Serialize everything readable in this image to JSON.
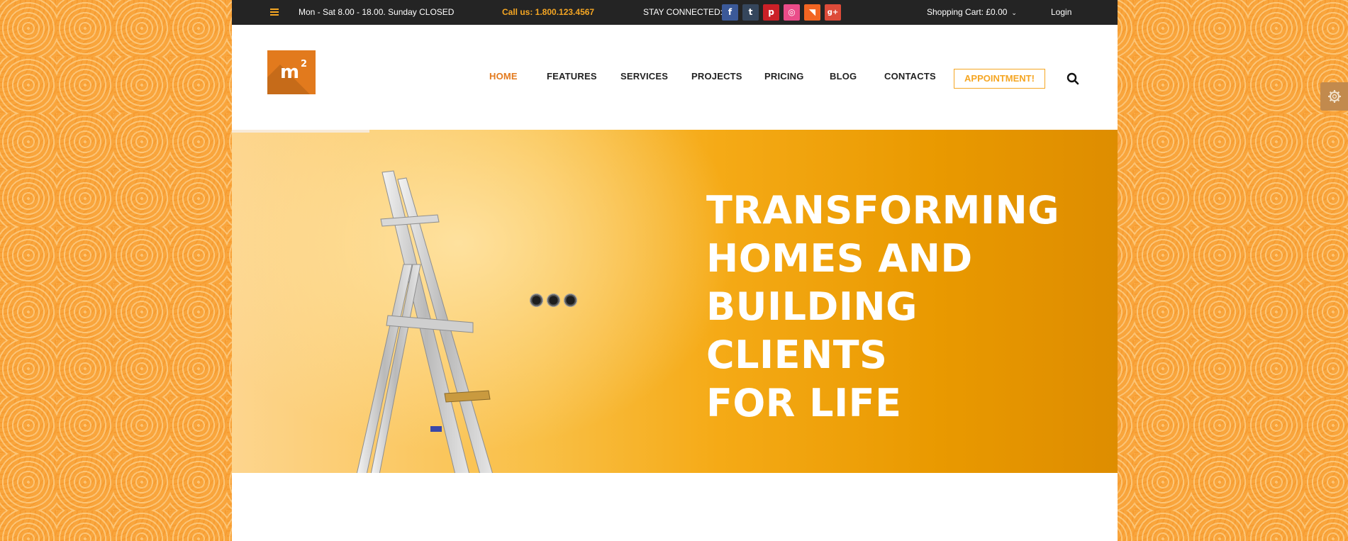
{
  "topbar": {
    "hours": "Mon - Sat 8.00 - 18.00. Sunday CLOSED",
    "call": "Call us: 1.800.123.4567",
    "stay_connected": "STAY CONNECTED:",
    "social": [
      {
        "name": "facebook-icon",
        "glyph": "f",
        "color": "#3b5998"
      },
      {
        "name": "tumblr-icon",
        "glyph": "t",
        "color": "#35465c"
      },
      {
        "name": "pinterest-icon",
        "glyph": "p",
        "color": "#cb2027"
      },
      {
        "name": "dribbble-icon",
        "glyph": "◎",
        "color": "#ea4c89"
      },
      {
        "name": "rss-icon",
        "glyph": "◥",
        "color": "#f26522"
      },
      {
        "name": "google-plus-icon",
        "glyph": "g+",
        "color": "#dd4b39"
      }
    ],
    "cart": "Shopping Cart: £0.00",
    "cart_chevron": "⌄",
    "login": "Login"
  },
  "logo": {
    "text": "m",
    "sup": "2"
  },
  "nav": {
    "items": [
      "HOME",
      "FEATURES",
      "SERVICES",
      "PROJECTS",
      "PRICING",
      "BLOG",
      "CONTACTS"
    ],
    "active_index": 0,
    "appointment": "APPOINTMENT!"
  },
  "hero": {
    "headline_lines": [
      "TRANSFORMING",
      "HOMES AND",
      "BUILDING CLIENTS",
      "FOR LIFE"
    ]
  },
  "colors": {
    "accent": "#e37a1d",
    "highlight": "#f5a623",
    "topbar_bg": "#242424"
  }
}
